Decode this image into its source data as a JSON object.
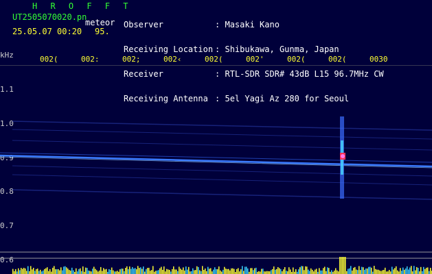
{
  "header": {
    "program": "H R O F F T",
    "filename": "UT2505070020.pn",
    "tag": "meteor",
    "datetime": "25.05.07 00:20",
    "value": "95.",
    "fields": [
      {
        "label": "Observer",
        "sep": ":",
        "value": "Masaki Kano"
      },
      {
        "label": "Receiving Location",
        "sep": ":",
        "value": "Shibukawa, Gunma, Japan"
      },
      {
        "label": "Receiver",
        "sep": ":",
        "value": "RTL-SDR SDR# 43dB L15 96.7MHz CW"
      },
      {
        "label": "Receiving Antenna",
        "sep": ":",
        "value": "5el Yagi Az 280 for Seoul"
      }
    ]
  },
  "time_axis": {
    "labels": [
      "002(",
      "002:",
      "002;",
      "002‹",
      "002(",
      "002'",
      "002(",
      "002(",
      "0030"
    ]
  },
  "freq_axis": {
    "unit": "kHz",
    "labels": [
      "1.1",
      "1.0",
      "0.9",
      "0.8",
      "0.7",
      "0.6"
    ]
  },
  "colors": {
    "background": "#00003a",
    "trace": "#3a7bff",
    "meteor": "#ff3355",
    "histogram": "#ffff33"
  }
}
